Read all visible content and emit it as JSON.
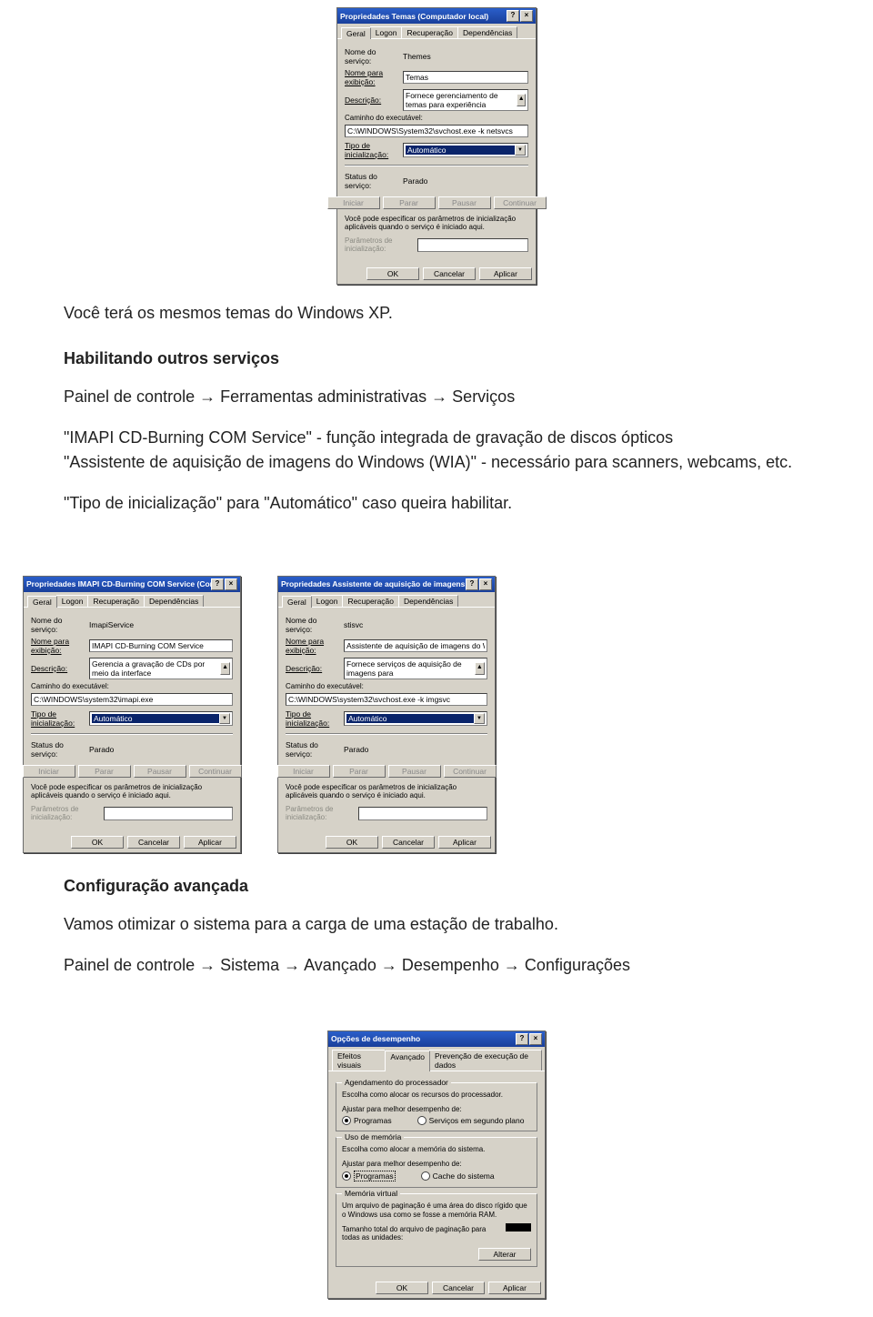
{
  "doc": {
    "p1": "Você terá os mesmos temas do Windows XP.",
    "h1": "Habilitando outros serviços",
    "p2": "Painel de controle → Ferramentas administrativas → Serviços",
    "p3": "\"IMAPI CD-Burning COM Service\" - função integrada de gravação de discos ópticos",
    "p4": "\"Assistente de aquisição de imagens do Windows (WIA)\" - necessário para scanners, webcams, etc.",
    "p5": "\"Tipo de inicialização\" para \"Automático\" caso queira habilitar.",
    "h2": "Configuração avançada",
    "p6": "Vamos otimizar o sistema para a carga de uma estação de trabalho.",
    "p7": "Painel de controle → Sistema → Avançado → Desempenho → Configurações"
  },
  "common": {
    "tab_geral": "Geral",
    "tab_logon": "Logon",
    "tab_rec": "Recuperação",
    "tab_dep": "Dependências",
    "lbl_service_name": "Nome do serviço:",
    "lbl_display_name": "Nome para exibição:",
    "lbl_desc": "Descrição:",
    "lbl_exe": "Caminho do executável:",
    "lbl_startup": "Tipo de inicialização:",
    "lbl_status": "Status do serviço:",
    "startup_auto": "Automático",
    "status_parado": "Parado",
    "btn_iniciar": "Iniciar",
    "btn_parar": "Parar",
    "btn_pausar": "Pausar",
    "btn_continuar": "Continuar",
    "note": "Você pode especificar os parâmetros de inicialização aplicáveis quando o serviço é iniciado aqui.",
    "lbl_params": "Parâmetros de inicialização:",
    "btn_ok": "OK",
    "btn_cancelar": "Cancelar",
    "btn_aplicar": "Aplicar",
    "help_q": "?",
    "close_x": "×"
  },
  "dlg_themes": {
    "title": "Propriedades Temas (Computador local)",
    "service_name": "Themes",
    "display_name": "Temas",
    "desc": "Fornece gerenciamento de temas para experiência",
    "exe": "C:\\WINDOWS\\System32\\svchost.exe -k netsvcs"
  },
  "dlg_imapi": {
    "title": "Propriedades IMAPI CD-Burning COM Service (Computador local)",
    "service_name": "ImapiService",
    "display_name": "IMAPI CD-Burning COM Service",
    "desc": "Gerencia a gravação de CDs por meio da interface",
    "exe": "C:\\WINDOWS\\system32\\imapi.exe"
  },
  "dlg_wia": {
    "title": "Propriedades Assistente de aquisição de imagens do Windows (...",
    "service_name": "stisvc",
    "display_name": "Assistente de aquisição de imagens do Windows (WIA)",
    "desc": "Fornece serviços de aquisição de imagens para",
    "exe": "C:\\WINDOWS\\system32\\svchost.exe -k imgsvc"
  },
  "perf": {
    "title": "Opções de desempenho",
    "tab_effects": "Efeitos visuais",
    "tab_adv": "Avançado",
    "tab_dep": "Prevenção de execução de dados",
    "g1_title": "Agendamento do processador",
    "g1_note": "Escolha como alocar os recursos do processador.",
    "adjust": "Ajustar para melhor desempenho de:",
    "r_prog": "Programas",
    "r_bg": "Serviços em segundo plano",
    "g2_title": "Uso de memória",
    "g2_note": "Escolha como alocar a memória do sistema.",
    "r_cache": "Cache do sistema",
    "g3_title": "Memória virtual",
    "g3_note": "Um arquivo de paginação é uma área do disco rígido que o Windows usa como se fosse a memória RAM.",
    "g3_total": "Tamanho total do arquivo de paginação para todas as unidades:",
    "btn_alterar": "Alterar"
  }
}
